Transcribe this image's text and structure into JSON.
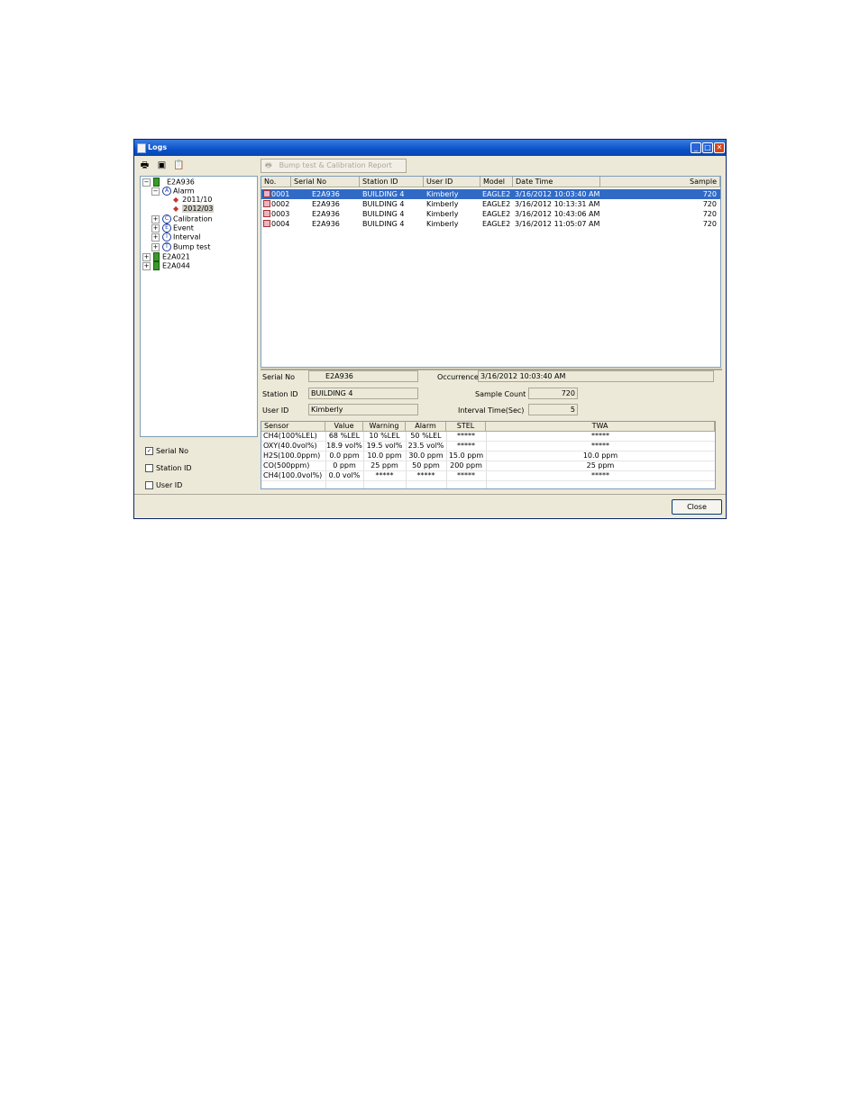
{
  "window": {
    "title": "Logs"
  },
  "toolbar": {
    "print_icon": "printer-icon",
    "save_icon": "floppy-disk-icon",
    "clipboard_icon": "clipboard-icon"
  },
  "report_button": {
    "label": "Bump test & Calibration Report",
    "icon": "printer-icon"
  },
  "tree": {
    "root": "E2A936",
    "alarm": "Alarm",
    "alarm_dates": [
      "2011/10",
      "2012/03"
    ],
    "calibration": "Calibration",
    "event": "Event",
    "interval": "Interval",
    "bump": "Bump test",
    "others": [
      "E2A021",
      "E2A044"
    ]
  },
  "filters": [
    {
      "label": "Serial No",
      "checked": true
    },
    {
      "label": "Station ID",
      "checked": false
    },
    {
      "label": "User ID",
      "checked": false
    }
  ],
  "list": {
    "columns": [
      "No.",
      "Serial No",
      "Station ID",
      "User ID",
      "Model",
      "Date Time",
      "Sample"
    ],
    "rows": [
      [
        "0001",
        "E2A936",
        "BUILDING 4",
        "Kimberly",
        "EAGLE2",
        "3/16/2012 10:03:40 AM",
        "720"
      ],
      [
        "0002",
        "E2A936",
        "BUILDING 4",
        "Kimberly",
        "EAGLE2",
        "3/16/2012 10:13:31 AM",
        "720"
      ],
      [
        "0003",
        "E2A936",
        "BUILDING 4",
        "Kimberly",
        "EAGLE2",
        "3/16/2012 10:43:06 AM",
        "720"
      ],
      [
        "0004",
        "E2A936",
        "BUILDING 4",
        "Kimberly",
        "EAGLE2",
        "3/16/2012 11:05:07 AM",
        "720"
      ]
    ]
  },
  "details": {
    "serial_label": "Serial No",
    "serial_value": "E2A936",
    "station_label": "Station ID",
    "station_value": "BUILDING 4",
    "user_label": "User ID",
    "user_value": "Kimberly",
    "occurrence_label": "Occurrence",
    "occurrence_value": "3/16/2012 10:03:40 AM",
    "sample_count_label": "Sample Count",
    "sample_count_value": "720",
    "interval_label": "Interval Time(Sec)",
    "interval_value": "5"
  },
  "sensors": {
    "columns": [
      "Sensor",
      "Value",
      "Warning",
      "Alarm",
      "STEL",
      "TWA"
    ],
    "rows": [
      [
        "CH4(100%LEL)",
        "68 %LEL",
        "10 %LEL",
        "50 %LEL",
        "*****",
        "*****"
      ],
      [
        "OXY(40.0vol%)",
        "18.9 vol%",
        "19.5 vol%",
        "23.5 vol%",
        "*****",
        "*****"
      ],
      [
        "H2S(100.0ppm)",
        "0.0 ppm",
        "10.0 ppm",
        "30.0 ppm",
        "15.0 ppm",
        "10.0 ppm"
      ],
      [
        "CO(500ppm)",
        "0 ppm",
        "25 ppm",
        "50 ppm",
        "200 ppm",
        "25 ppm"
      ],
      [
        "CH4(100.0vol%)",
        "0.0 vol%",
        "*****",
        "*****",
        "*****",
        "*****"
      ]
    ]
  },
  "close_button": "Close"
}
